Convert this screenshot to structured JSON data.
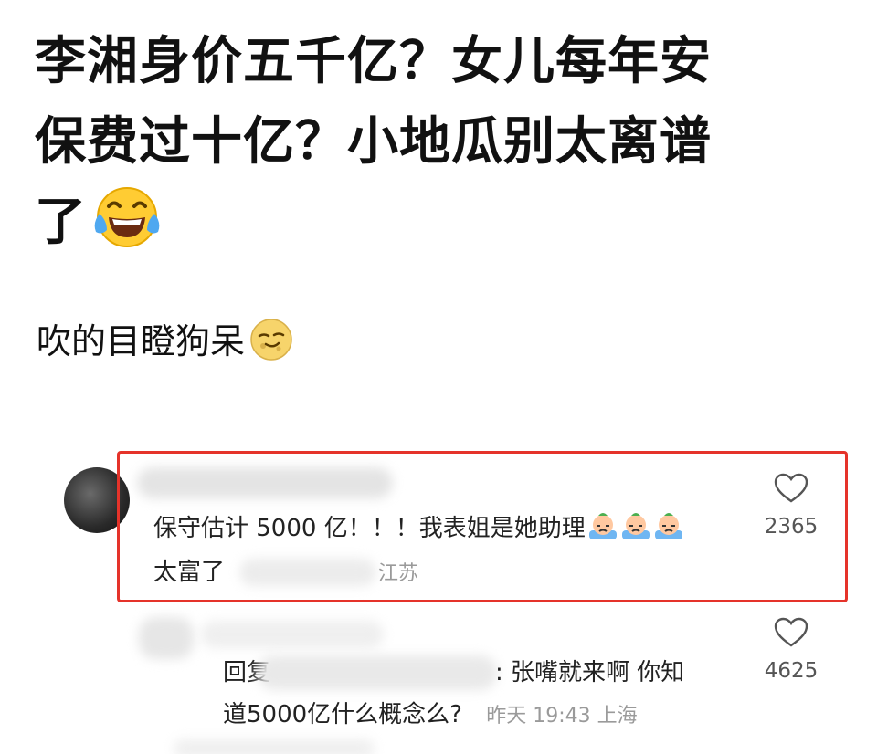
{
  "post": {
    "headline_lines": [
      "李湘身价五千亿？女儿每年安",
      "保费过十亿？小地瓜别太离谱",
      "了"
    ],
    "body": "吹的目瞪狗呆"
  },
  "comments": [
    {
      "text_line1": "保守估计 5000 亿！！！我表姐是她助理",
      "text_line2": "太富了",
      "location_fragment": "江苏",
      "likes": "2365",
      "highlighted": true
    },
    {
      "reply_prefix": "回复",
      "text_line1": ": 张嘴就来啊 你知",
      "text_line2": "道5000亿什么概念么?",
      "timestamp": "昨天 19:43 上海",
      "likes": "4625"
    }
  ],
  "icons": [
    "laughing-tears-emoji",
    "smirk-moon-emoji",
    "crying-baby-emoji",
    "heart-outline-icon"
  ],
  "colors": {
    "highlight": "#e5332a",
    "meta": "#9a9a9a"
  }
}
